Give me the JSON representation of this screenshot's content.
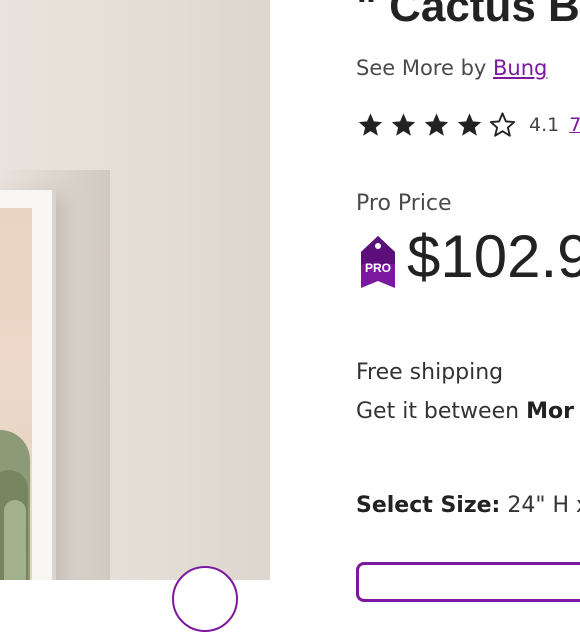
{
  "product": {
    "title": "\" Cactus B",
    "see_more_prefix": "See More by ",
    "brand_link": "Bung"
  },
  "rating": {
    "stars_filled": 4,
    "stars_total": 5,
    "value": "4.1",
    "count_link": "7"
  },
  "pricing": {
    "label": "Pro Price",
    "badge_text": "PRO",
    "price": "$102.9"
  },
  "shipping": {
    "title": "Free shipping",
    "dates_prefix": "Get it between ",
    "dates_bold": "Mor"
  },
  "size": {
    "label": "Select Size:",
    "value": " 24\" H x"
  },
  "colors": {
    "accent": "#7b189f",
    "text": "#2b2b2b"
  },
  "icons": {
    "pro_badge": "pro-price-tag-icon",
    "star_filled": "star-filled-icon",
    "star_empty": "star-outline-icon"
  }
}
